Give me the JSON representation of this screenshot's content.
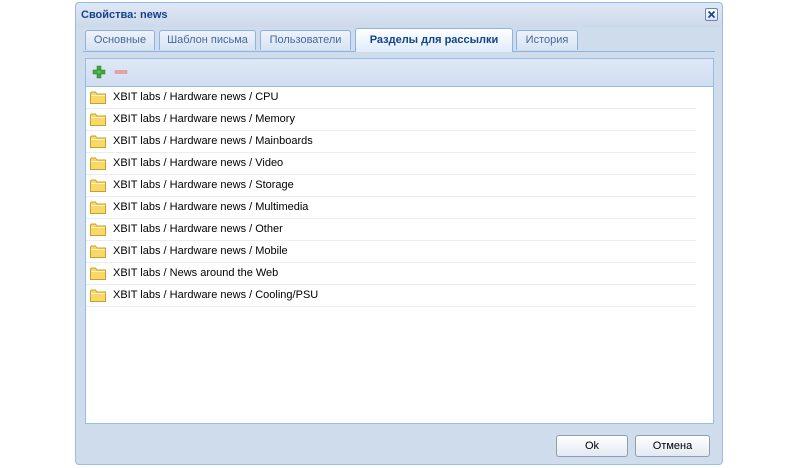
{
  "window": {
    "title": "Свойства: news"
  },
  "tabs": [
    {
      "label": "Основные",
      "active": false
    },
    {
      "label": "Шаблон письма",
      "active": false
    },
    {
      "label": "Пользователи",
      "active": false
    },
    {
      "label": "Разделы для рассылки",
      "active": true
    },
    {
      "label": "История",
      "active": false
    }
  ],
  "toolbar": {
    "add_icon": "plus-icon",
    "remove_icon": "minus-icon",
    "add_color": "#3fa83f",
    "remove_color": "#e9a0a8"
  },
  "sections": [
    "XBIT labs / Hardware news / CPU",
    "XBIT labs / Hardware news / Memory",
    "XBIT labs / Hardware news / Mainboards",
    "XBIT labs / Hardware news / Video",
    "XBIT labs / Hardware news / Storage",
    "XBIT labs / Hardware news / Multimedia",
    "XBIT labs / Hardware news / Other",
    "XBIT labs / Hardware news / Mobile",
    "XBIT labs / News around the Web",
    "XBIT labs / Hardware news / Cooling/PSU"
  ],
  "buttons": {
    "ok": "Ok",
    "cancel": "Отмена"
  }
}
